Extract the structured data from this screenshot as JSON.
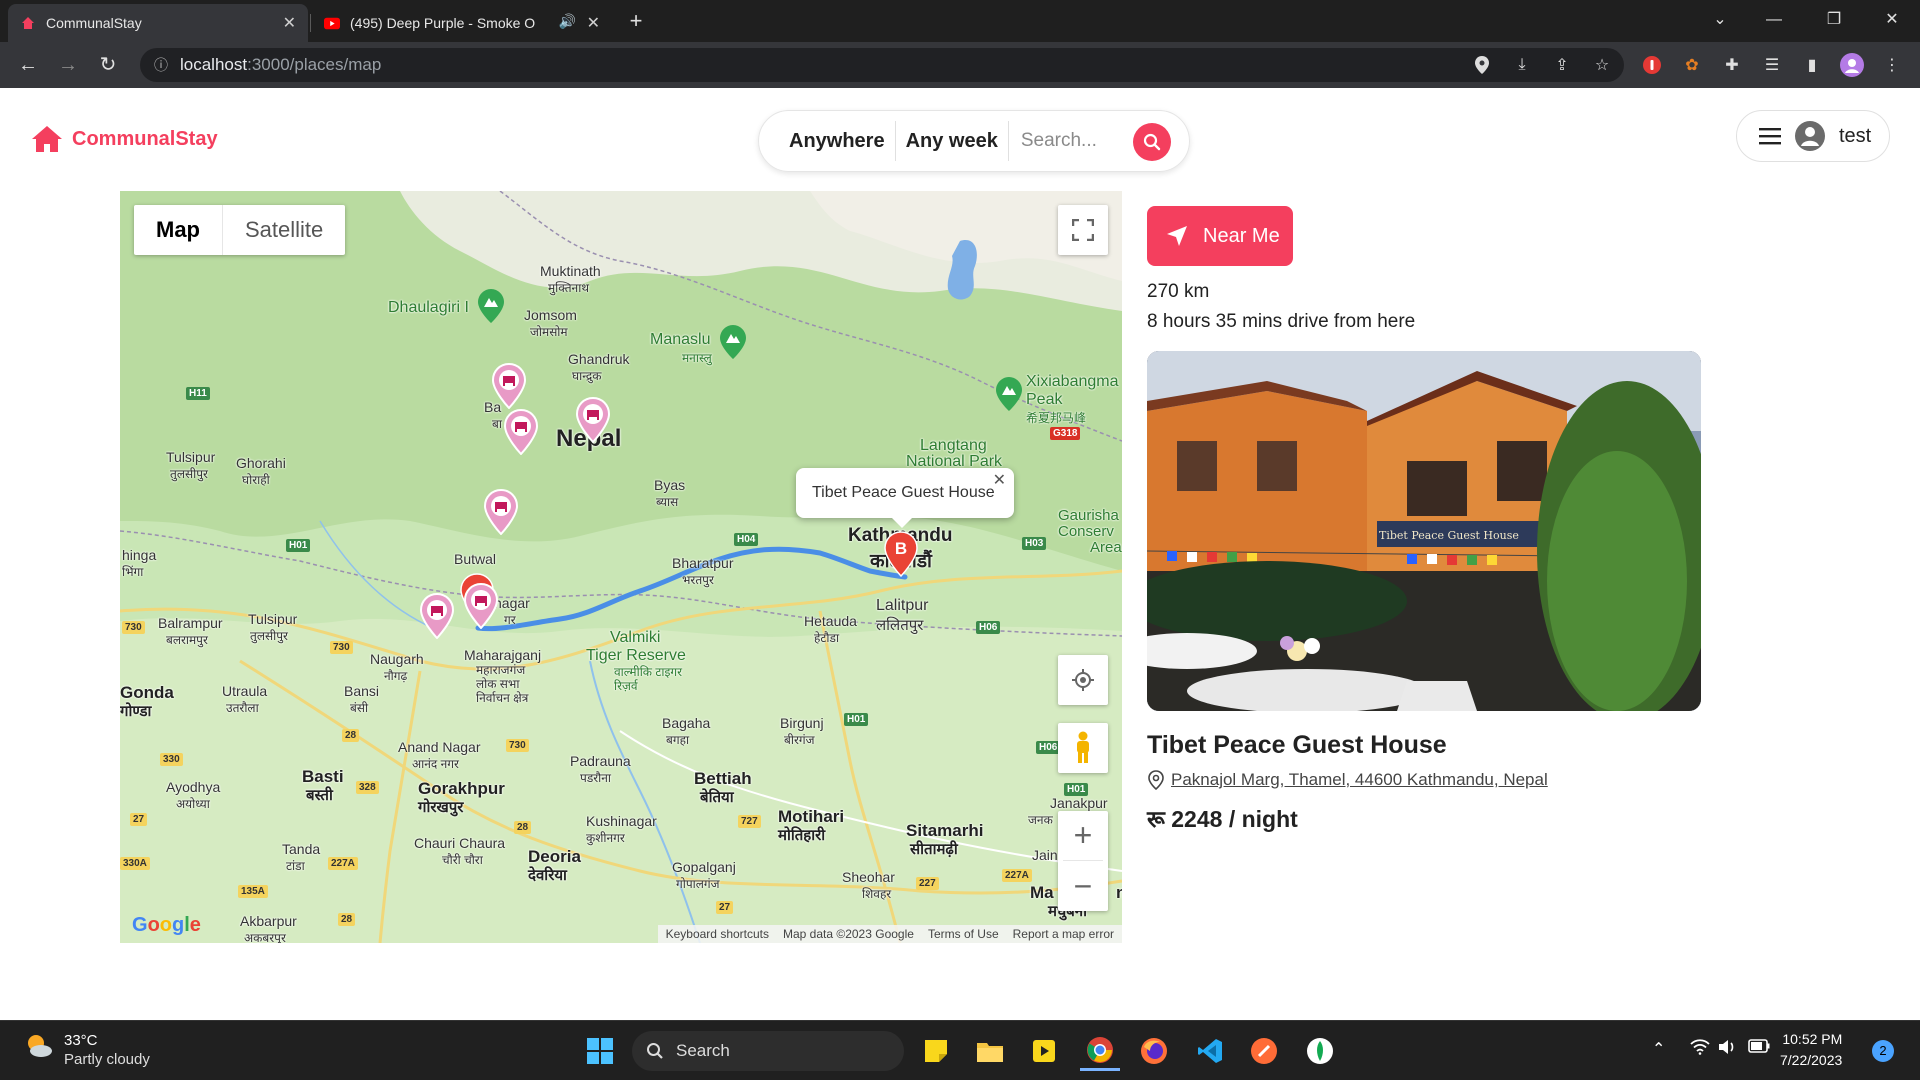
{
  "browser": {
    "tabs": [
      {
        "title": "CommunalStay",
        "active": true
      },
      {
        "title": "(495) Deep Purple - Smoke O",
        "active": false
      }
    ],
    "url_host": "localhost",
    "url_path": ":3000/places/map"
  },
  "header": {
    "logo_text": "CommunalStay",
    "search": {
      "anywhere": "Anywhere",
      "any_week": "Any week",
      "placeholder": "Search..."
    },
    "user_name": "test"
  },
  "map": {
    "type_map": "Map",
    "type_satellite": "Satellite",
    "labels": {
      "muktinath": "Muktinath",
      "muktinath_dev": "मुक्तिनाथ",
      "dhaulagiri": "Dhaulagiri I",
      "jomsom": "Jomsom",
      "jomsom_dev": "जोमसोम",
      "ghandruk": "Ghandruk",
      "ghandruk_dev": "घान्द्रुक",
      "manaslu": "Manaslu",
      "manaslu_dev": "मनास्लु",
      "xixiabangma": "Xixiabangma",
      "peak": "Peak",
      "xixia_cn": "希夏邦马峰",
      "nepal": "Nepal",
      "langtang": "Langtang",
      "national_park": "National Park",
      "tulsipur": "Tulsipur",
      "tulsipur_dev": "तुलसीपुर",
      "ghorahi": "Ghorahi",
      "ghorahi_dev": "घोराही",
      "byas": "Byas",
      "byas_dev": "ब्यास",
      "kathmandu": "Kathmandu",
      "kathmandu_dev": "काठमाडौं",
      "gaurisha": "Gaurisha",
      "conserv": "Conserv",
      "area": "Area",
      "hinga": "hinga",
      "hinga_dev": "भिंगा",
      "butwal": "Butwal",
      "bharatpur": "Bharatpur",
      "bharatpur_dev": "भरतपुर",
      "lalitpur": "Lalitpur",
      "lalitpur_dev": "ललितपुर",
      "bhairahawa": "nagar",
      "bhairahawa_dev": "गर",
      "balrampur": "Balrampur",
      "balrampur_dev": "बलरामपुर",
      "tulsipur2": "Tulsipur",
      "tulsipur2_dev": "तुलसीपुर",
      "hetauda": "Hetauda",
      "hetauda_dev": "हेटौडा",
      "valmiki": "Valmiki",
      "tiger_reserve": "Tiger Reserve",
      "valmiki_dev": "वाल्मीकि टाइगर रिज़र्व",
      "naugarh": "Naugarh",
      "naugarh_dev": "नौगढ़",
      "maharajganj": "Maharajganj",
      "maharajganj_dev": "महाराजगंज लोक सभा निर्वाचन क्षेत्र",
      "gonda": "Gonda",
      "gonda_dev": "गोण्डा",
      "utraula": "Utraula",
      "utraula_dev": "उतरौला",
      "bansi": "Bansi",
      "bansi_dev": "बंसी",
      "bagaha": "Bagaha",
      "bagaha_dev": "बगहा",
      "birgunj": "Birgunj",
      "birgunj_dev": "बीरगंज",
      "anand_nagar": "Anand Nagar",
      "anand_nagar_dev": "आनंद नगर",
      "padrauna": "Padrauna",
      "padrauna_dev": "पडरौना",
      "bettiah": "Bettiah",
      "bettiah_dev": "बेतिया",
      "ayodhya": "Ayodhya",
      "ayodhya_dev": "अयोध्या",
      "basti": "Basti",
      "basti_dev": "बस्ती",
      "gorakhpur": "Gorakhpur",
      "gorakhpur_dev": "गोरखपुर",
      "kushinagar": "Kushinagar",
      "kushinagar_dev": "कुशीनगर",
      "motihari": "Motihari",
      "motihari_dev": "मोतिहारी",
      "sitamarhi": "Sitamarhi",
      "sitamarhi_dev": "सीतामढ़ी",
      "janakpur": "Janakpur",
      "janakpur_dev": "जनक",
      "chauri": "Chauri Chaura",
      "chauri_dev": "चौरी चौरा",
      "deoria": "Deoria",
      "deoria_dev": "देवरिया",
      "tanda": "Tanda",
      "tanda_dev": "टांडा",
      "gopalganj": "Gopalganj",
      "gopalganj_dev": "गोपालगंज",
      "sheohar": "Sheohar",
      "sheohar_dev": "शिवहर",
      "jain": "Jain",
      "madhubani": "Ma",
      "madhubani_tail": "n",
      "madhubani_dev": "मधुबनी",
      "akbarpur": "Akbarpur",
      "akbarpur_dev": "अकबरपुर",
      "ba": "Ba",
      "ba_dev": "बा"
    },
    "highways": [
      "H11",
      "H01",
      "H04",
      "H03",
      "H06",
      "H01",
      "H06",
      "H01",
      "G318",
      "730",
      "730",
      "28",
      "330",
      "328",
      "730",
      "28",
      "727",
      "27",
      "27",
      "135A",
      "227A",
      "330A",
      "28",
      "227",
      "227A"
    ],
    "infowindow_title": "Tibet Peace Guest House",
    "marker_b_label": "B",
    "attribution": {
      "shortcuts": "Keyboard shortcuts",
      "data": "Map data ©2023 Google",
      "terms": "Terms of Use",
      "report": "Report a map error"
    },
    "google_logo": "Google"
  },
  "panel": {
    "near_me": "Near Me",
    "distance": "270 km",
    "duration": "8 hours 35 mins drive from here",
    "place_name": "Tibet Peace Guest House",
    "address": "Paknajol Marg, Thamel, 44600 Kathmandu, Nepal",
    "price": "रू 2248 / night",
    "sign_text": "Tibet Peace Guest House"
  },
  "taskbar": {
    "temperature": "33°C",
    "weather": "Partly cloudy",
    "search": "Search",
    "time": "10:52 PM",
    "date": "7/22/2023",
    "notifications": "2"
  },
  "colors": {
    "brand": "#f43f5e",
    "route": "#4a8ee6"
  }
}
